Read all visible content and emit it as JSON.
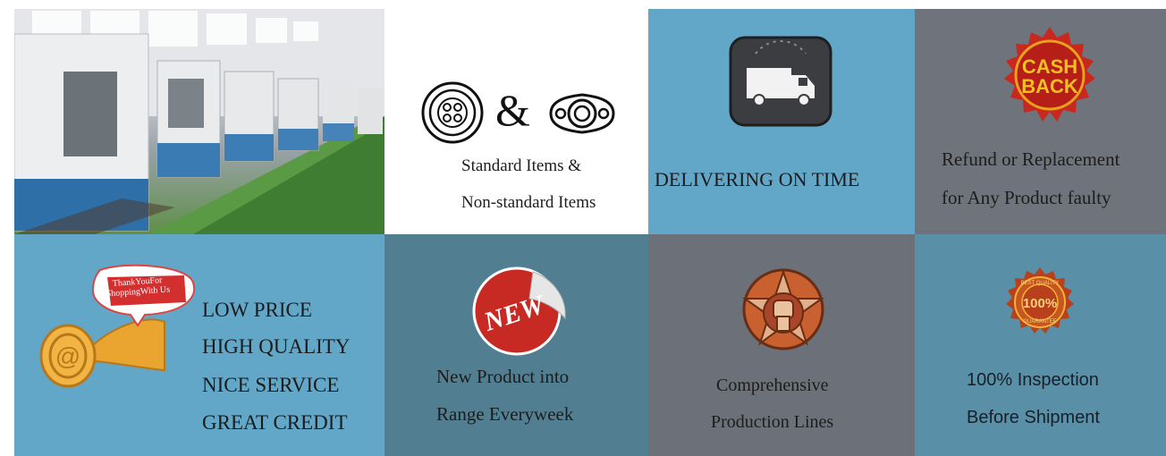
{
  "tiles": {
    "standard": {
      "ampersand": "&",
      "line1": "Standard Items &",
      "line2": "Non-standard Items"
    },
    "deliver": {
      "label": "DELIVERING ON TIME"
    },
    "refund": {
      "badge_line1": "CASH",
      "badge_line2": "BACK",
      "line1": "Refund or Replacement",
      "line2": "for Any Product faulty"
    },
    "low": {
      "bubble_text": "ThankYouFor ShoppingWith Us",
      "lines": [
        "LOW PRICE",
        "HIGH QUALITY",
        "NICE SERVICE",
        "GREAT CREDIT"
      ]
    },
    "new": {
      "sticker": "NEW",
      "line1": "New Product into",
      "line2": "Range Everyweek"
    },
    "comp": {
      "line1": "Comprehensive",
      "line2": "Production Lines"
    },
    "insp": {
      "seal_top": "BEST QUALITY",
      "seal_center": "100%",
      "seal_bottom": "GUARANTEE",
      "line1": "100% Inspection",
      "line2": "Before Shipment"
    }
  },
  "colors": {
    "blue_tile": "#62a7c7",
    "teal_tile": "#517f91",
    "gray_tile": "#6f737b",
    "badge_red": "#c8281e",
    "badge_gold": "#e8a21a"
  }
}
